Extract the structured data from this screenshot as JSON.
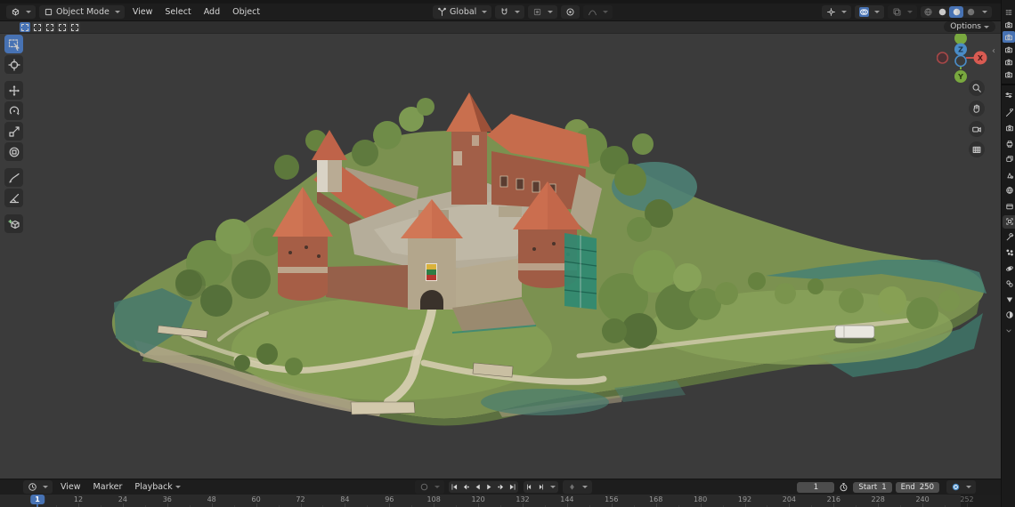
{
  "colors": {
    "accent": "#4772b3",
    "viewport_bg": "#3b3b3b",
    "header_bg": "#1d1d1d",
    "object_tab_orange": "#e8913c"
  },
  "viewport_header": {
    "editor_icon": "3d-viewport-editor",
    "mode_label": "Object Mode",
    "menus": [
      "View",
      "Select",
      "Add",
      "Object"
    ],
    "orientation_label": "Global",
    "right_toggles": [
      "show-gizmos",
      "show-overlays",
      "toggle-xray"
    ],
    "shading_modes": [
      "wireframe",
      "solid",
      "material-preview",
      "rendered"
    ],
    "shading_active_index": 2
  },
  "tool_settings": {
    "select_modes": [
      "set",
      "extend",
      "subtract",
      "invert",
      "intersect"
    ],
    "active_index": 0,
    "options_label": "Options"
  },
  "toolbar": {
    "tools": [
      {
        "id": "select-box",
        "active": true
      },
      {
        "id": "cursor",
        "active": false
      },
      {
        "id": "move",
        "active": false
      },
      {
        "id": "rotate",
        "active": false
      },
      {
        "id": "scale",
        "active": false
      },
      {
        "id": "transform",
        "active": false
      },
      {
        "id": "annotate",
        "active": false
      },
      {
        "id": "measure",
        "active": false
      },
      {
        "id": "add-cube",
        "active": false
      }
    ]
  },
  "gizmo": {
    "x_label": "X",
    "y_label": "Y",
    "z_label": "Z"
  },
  "nav_buttons": [
    "zoom",
    "pan",
    "camera-view",
    "toggle-ortho"
  ],
  "scene": {
    "subject": "Photogrammetry 3D scan of Trakai Island Castle — red-roofed brick towers and stone walls on a green tree-covered island"
  },
  "outliner": {
    "items": [
      {
        "icon": "camera"
      },
      {
        "icon": "camera"
      },
      {
        "icon": "camera"
      },
      {
        "icon": "camera"
      },
      {
        "icon": "camera"
      }
    ],
    "active_index": 1
  },
  "properties_panel": {
    "tabs": [
      {
        "id": "tool",
        "active": false
      },
      {
        "id": "render",
        "active": false
      },
      {
        "id": "output",
        "active": false
      },
      {
        "id": "view-layer",
        "active": false
      },
      {
        "id": "scene",
        "active": false
      },
      {
        "id": "world",
        "active": false
      },
      {
        "id": "collection",
        "active": false
      },
      {
        "id": "object",
        "active": true
      },
      {
        "id": "modifiers",
        "active": false
      },
      {
        "id": "particles",
        "active": false
      },
      {
        "id": "physics",
        "active": false
      },
      {
        "id": "constraints",
        "active": false
      },
      {
        "id": "object-data",
        "active": false
      },
      {
        "id": "material",
        "active": false
      }
    ]
  },
  "timeline": {
    "menus": [
      "View",
      "Marker",
      "Playback"
    ],
    "transport": [
      "jump-to-start",
      "previous-keyframe",
      "play-reverse",
      "play",
      "next-keyframe",
      "jump-to-end"
    ],
    "frame_step": [
      "previous-frame",
      "next-frame"
    ],
    "current_frame": "1",
    "frame_field_value": "1",
    "start_label": "Start",
    "start_value": "1",
    "end_label": "End",
    "end_value": "250",
    "ruler_labels": [
      "12",
      "24",
      "36",
      "48",
      "60",
      "72",
      "84",
      "96",
      "108",
      "120",
      "132",
      "144",
      "156",
      "168",
      "180",
      "192",
      "204",
      "216",
      "228",
      "240",
      "252"
    ]
  }
}
